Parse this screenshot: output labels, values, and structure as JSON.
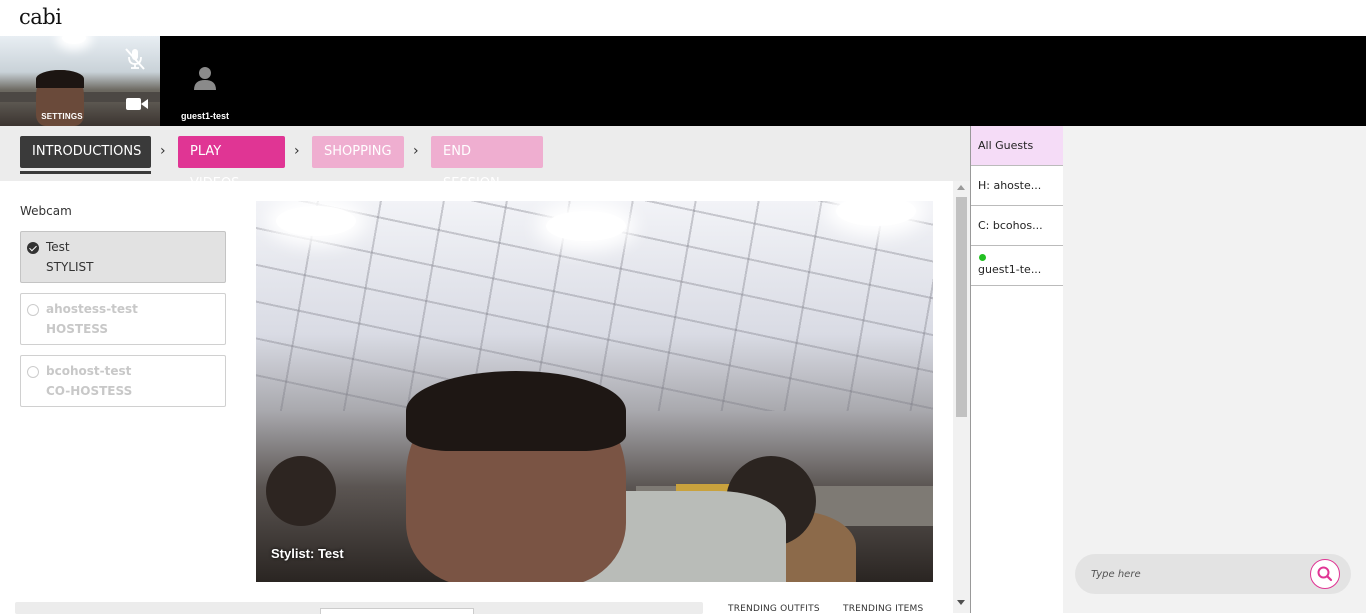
{
  "app": {
    "logo": "cabi"
  },
  "video_strip": {
    "self": {
      "settings_label": "SETTINGS"
    },
    "guest": {
      "name": "guest1-test"
    }
  },
  "steps": [
    {
      "label": "INTRODUCTIONS",
      "state": "active"
    },
    {
      "label": "PLAY VIDEOS",
      "state": "available"
    },
    {
      "label": "SHOPPING",
      "state": "disabled"
    },
    {
      "label": "END SESSION",
      "state": "disabled"
    }
  ],
  "webcam": {
    "label": "Webcam",
    "people": [
      {
        "name": "Test",
        "role": "STYLIST",
        "selected": true
      },
      {
        "name": "ahostess-test",
        "role": "HOSTESS",
        "selected": false
      },
      {
        "name": "bcohost-test",
        "role": "CO-HOSTESS",
        "selected": false
      }
    ],
    "caption": "Stylist: Test"
  },
  "bottom": {
    "trending_outfits": "TRENDING OUTFITS",
    "trending_items": "TRENDING ITEMS"
  },
  "guest_list": [
    {
      "label": "All Guests",
      "active": true
    },
    {
      "label": "H: ahoste...",
      "active": false
    },
    {
      "label": "C: bcohos...",
      "active": false
    },
    {
      "label": "guest1-te...",
      "active": false,
      "online": true
    }
  ],
  "chat": {
    "placeholder": "Type here"
  },
  "colors": {
    "accent": "#e03594",
    "accent_light": "#efaed0",
    "dark": "#3a3a3a",
    "online": "#22c022",
    "guest_active": "#f5dcf7"
  }
}
